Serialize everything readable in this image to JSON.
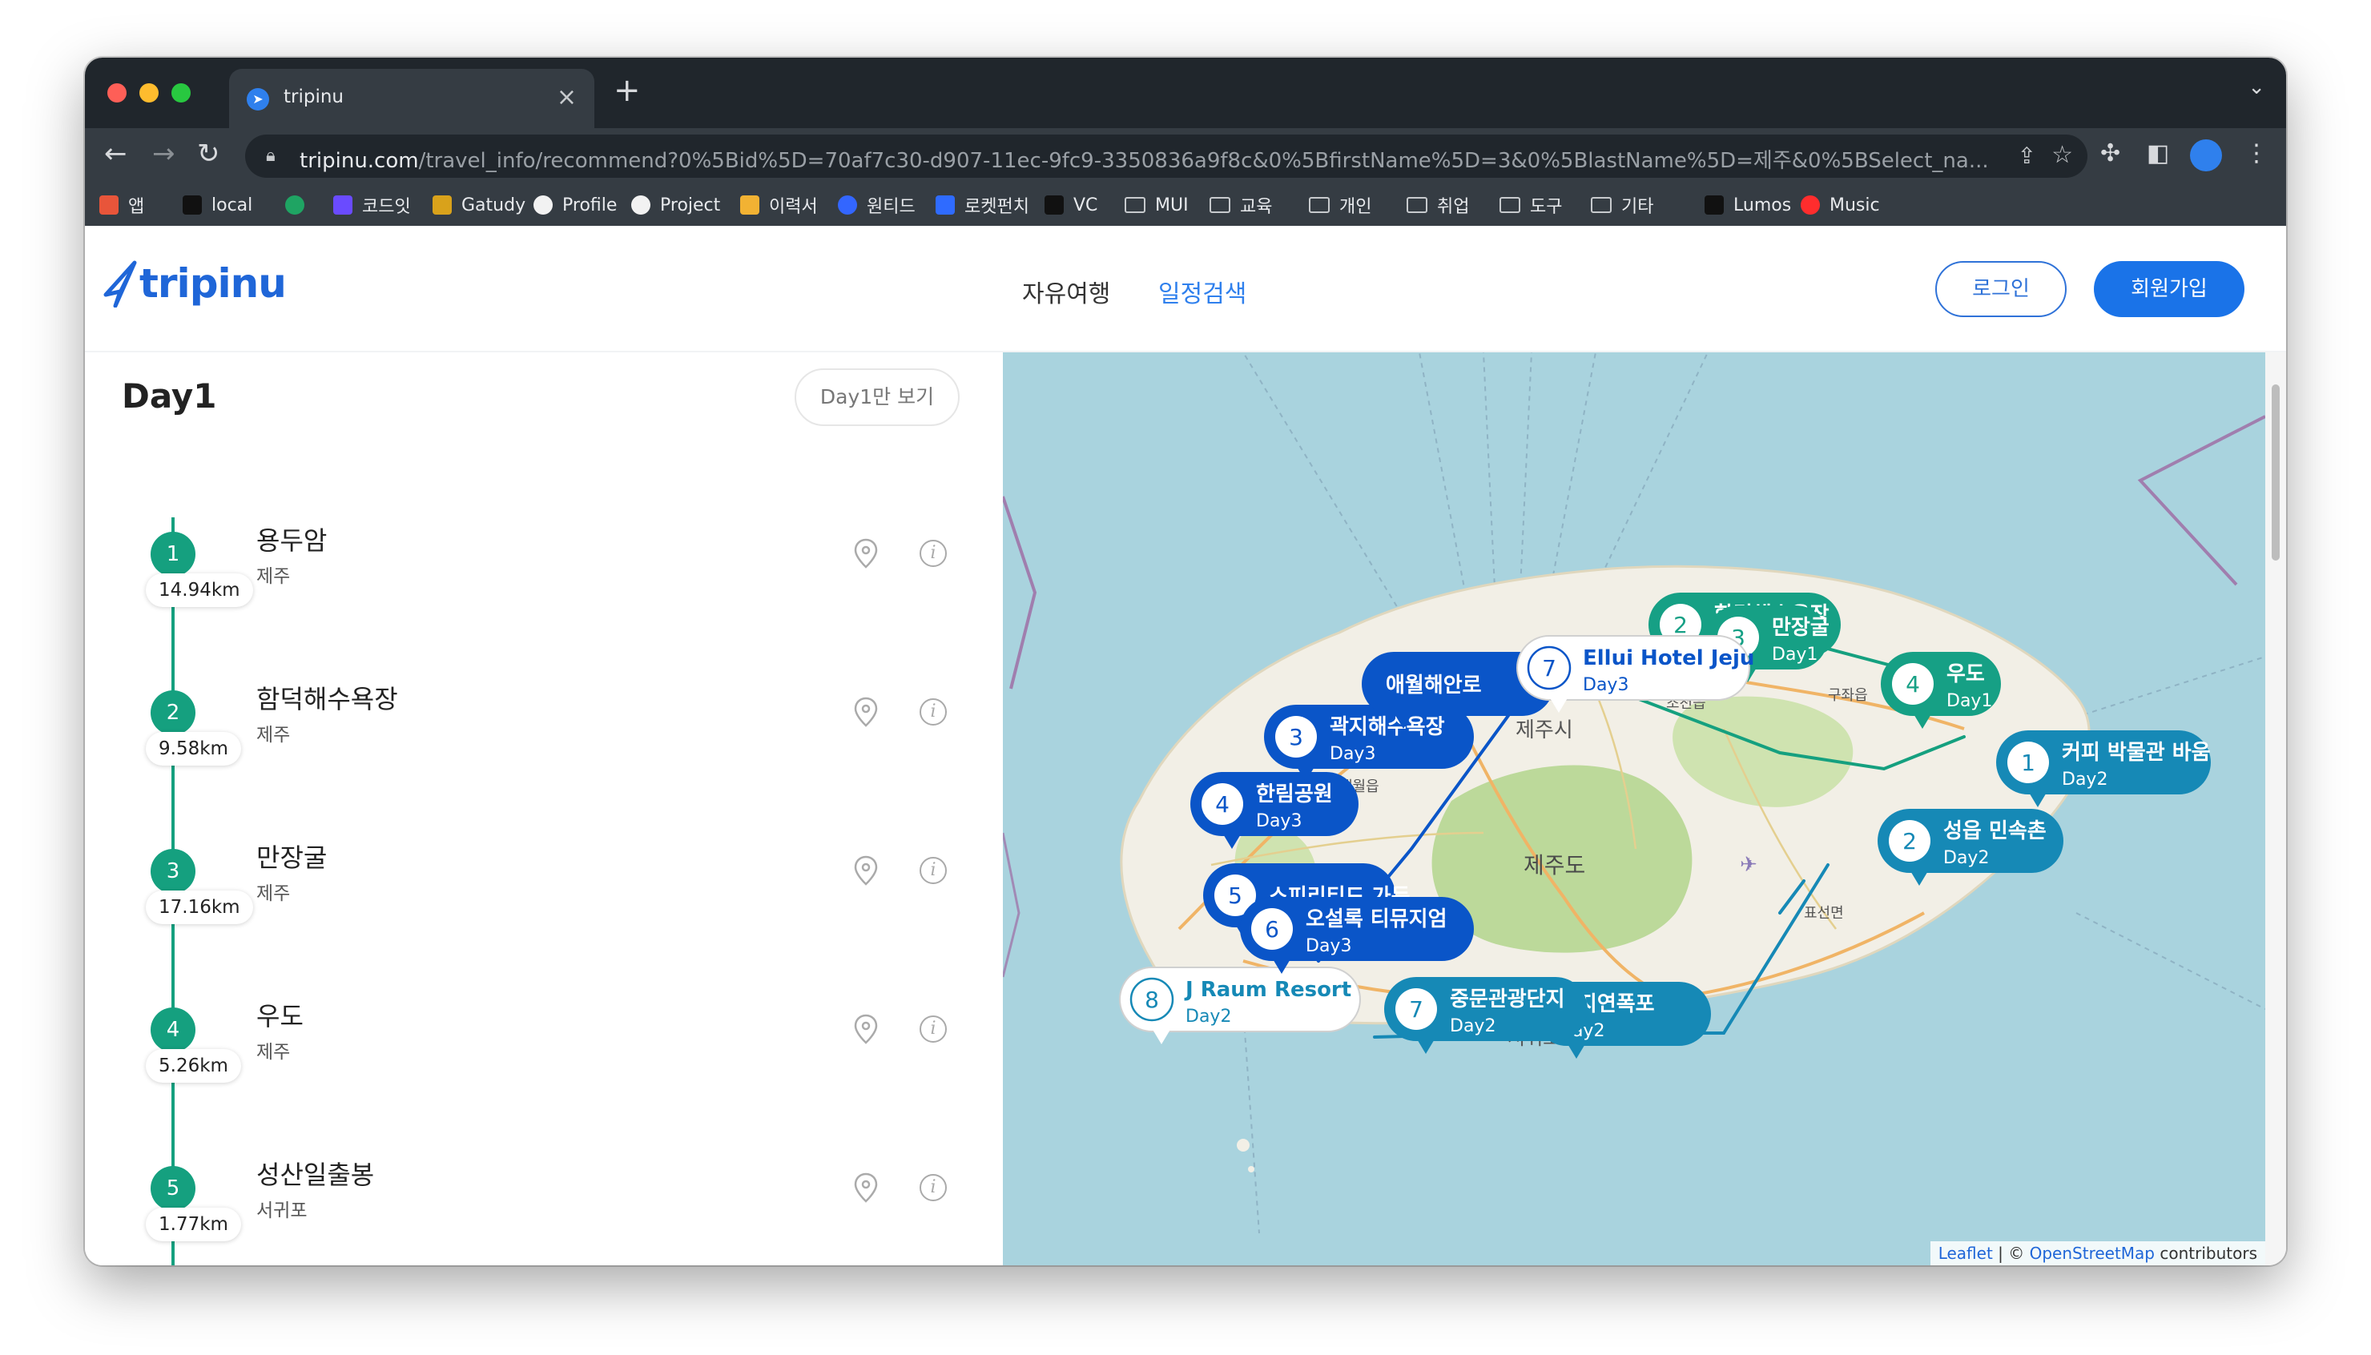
{
  "browser": {
    "tab_title": "tripinu",
    "url_host": "tripinu.com",
    "url_path": "/travel_info/recommend?0%5Bid%5D=70af7c30-d907-11ec-9fc9-3350836a9f8c&0%5BfirstName%5D=3&0%5BlastName%5D=제주&0%5BSelect_na...",
    "bookmarks": [
      {
        "label": "앱",
        "icon": "apps-grid-icon"
      },
      {
        "label": "local",
        "icon": "local-icon"
      },
      {
        "label": "",
        "icon": "edge-icon"
      },
      {
        "label": "코드잇",
        "icon": "codeit-icon"
      },
      {
        "label": "Gatudy",
        "icon": "gatudy-icon"
      },
      {
        "label": "Profile",
        "icon": "github-icon"
      },
      {
        "label": "Project",
        "icon": "github-icon"
      },
      {
        "label": "이력서",
        "icon": "resume-icon"
      },
      {
        "label": "원티드",
        "icon": "wanted-icon"
      },
      {
        "label": "로켓펀치",
        "icon": "rocketpunch-icon"
      },
      {
        "label": "VC",
        "icon": "vc-icon"
      },
      {
        "label": "MUI",
        "icon": "folder-icon"
      },
      {
        "label": "교육",
        "icon": "folder-icon"
      },
      {
        "label": "개인",
        "icon": "folder-icon"
      },
      {
        "label": "취업",
        "icon": "folder-icon"
      },
      {
        "label": "도구",
        "icon": "folder-icon"
      },
      {
        "label": "기타",
        "icon": "folder-icon"
      },
      {
        "label": "Lumos",
        "icon": "lumos-icon"
      },
      {
        "label": "Music",
        "icon": "music-icon"
      }
    ]
  },
  "header": {
    "logo_text": "tripinu",
    "nav": [
      "자유여행",
      "일정검색"
    ],
    "login_label": "로그인",
    "join_label": "회원가입"
  },
  "itinerary": {
    "day_title": "Day1",
    "day_only_button": "Day1만 보기",
    "spots": [
      {
        "number": "1",
        "name": "용두암",
        "region": "제주"
      },
      {
        "number": "2",
        "name": "함덕해수욕장",
        "region": "제주"
      },
      {
        "number": "3",
        "name": "만장굴",
        "region": "제주"
      },
      {
        "number": "4",
        "name": "우도",
        "region": "제주"
      },
      {
        "number": "5",
        "name": "성산일출봉",
        "region": "서귀포"
      }
    ],
    "distances": [
      "14.94km",
      "9.58km",
      "17.16km",
      "5.26km",
      "1.77km"
    ]
  },
  "map": {
    "place_labels": [
      "제주시",
      "제주도",
      "서귀포시",
      "애월읍",
      "조천읍",
      "구좌읍",
      "표선면",
      "제주시"
    ],
    "markers": [
      {
        "number": "2",
        "name": "함덕해수욕장",
        "day": "Day1",
        "color": "#16a085"
      },
      {
        "number": "3",
        "name": "만장굴",
        "day": "Day1",
        "color": "#16a085"
      },
      {
        "number": "4",
        "name": "우도",
        "day": "Day1",
        "color": "#16a085"
      },
      {
        "number": "1",
        "name": "커피 박물관 바움",
        "day": "Day2",
        "color": "#1689b6"
      },
      {
        "number": "2",
        "name": "성읍 민속촌",
        "day": "Day2",
        "color": "#1689b6"
      },
      {
        "number": "7",
        "name": "중문관광단지",
        "day": "Day2",
        "color": "#1689b6"
      },
      {
        "number": "",
        "name": "천지연폭포",
        "day": "Day2",
        "color": "#1689b6"
      },
      {
        "number": "8",
        "name": "J Raum Resort",
        "day": "Day2",
        "color": "#ffffff"
      },
      {
        "number": "7",
        "name": "Ellui Hotel Jeju",
        "day": "Day3",
        "color": "#ffffff"
      },
      {
        "number": "",
        "name": "애월해안로",
        "day": "",
        "color": "#0a55c8"
      },
      {
        "number": "3",
        "name": "곽지해수욕장",
        "day": "Day3",
        "color": "#0a55c8"
      },
      {
        "number": "4",
        "name": "한림공원",
        "day": "Day3",
        "color": "#0a55c8"
      },
      {
        "number": "5",
        "name": "스피리티드 가든",
        "day": "",
        "color": "#0a55c8"
      },
      {
        "number": "6",
        "name": "오설록 티뮤지엄",
        "day": "Day3",
        "color": "#0a55c8"
      }
    ],
    "attribution_link": "Leaflet",
    "attribution_osm": "OpenStreetMap",
    "attribution_suffix": " contributors"
  }
}
